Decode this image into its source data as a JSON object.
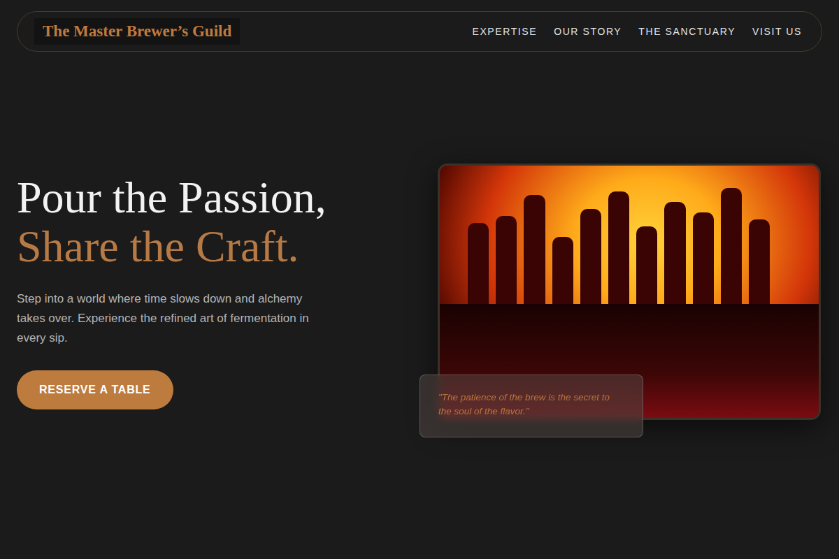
{
  "nav": {
    "logo": "The Master Brewer’s Guild",
    "links": [
      "EXPERTISE",
      "OUR STORY",
      "THE SANCTUARY",
      "VISIT US"
    ]
  },
  "hero": {
    "title_line1": "Pour the Passion,",
    "title_line2": "Share the Craft.",
    "description": "Step into a world where time slows down and alchemy takes over. Experience the refined art of fermentation in every sip.",
    "button": "RESERVE A TABLE"
  },
  "quote": {
    "text": "\"The patience of the brew is the secret to the soul of the flavor.\""
  }
}
